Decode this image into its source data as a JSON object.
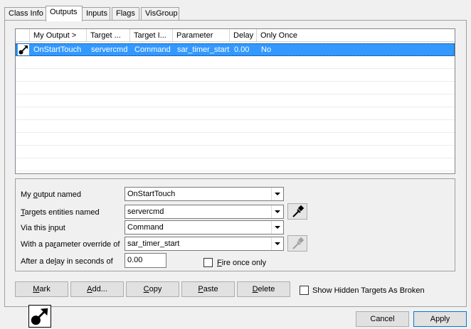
{
  "tabs": [
    "Class Info",
    "Outputs",
    "Inputs",
    "Flags",
    "VisGroup"
  ],
  "active_tab": "Outputs",
  "outputs_list": {
    "columns": [
      "My Output  >",
      "Target ...",
      "Target I...",
      "Parameter",
      "Delay",
      "Only Once"
    ],
    "rows": [
      {
        "output": "OnStartTouch",
        "target": "servercmd",
        "input": "Command",
        "parameter": "sar_timer_start",
        "delay": "0.00",
        "only_once": "No"
      }
    ]
  },
  "form": {
    "output_named_label_pre": "My ",
    "output_named_label_u": "o",
    "output_named_label_post": "utput named",
    "output_named_value": "OnStartTouch",
    "targets_label_u": "T",
    "targets_label_post": "argets entities named",
    "targets_value": "servercmd",
    "via_input_label_pre": "Via this ",
    "via_input_label_u": "i",
    "via_input_label_post": "nput",
    "via_input_value": "Command",
    "param_label_pre": "With a pa",
    "param_label_u": "r",
    "param_label_post": "ameter override of",
    "param_value": "sar_timer_start",
    "delay_label_pre": "After a de",
    "delay_label_u": "l",
    "delay_label_post": "ay in seconds of",
    "delay_value": "0.00",
    "fire_once_u": "F",
    "fire_once_post": "ire once only"
  },
  "buttons": {
    "mark_u": "M",
    "mark_post": "ark",
    "add_u": "A",
    "add_post": "dd...",
    "copy_u": "C",
    "copy_post": "opy",
    "paste_u": "P",
    "paste_post": "aste",
    "delete_u": "D",
    "delete_post": "elete",
    "show_hidden": "Show Hidden Targets As Broken",
    "cancel": "Cancel",
    "apply": "Apply"
  },
  "icons": {
    "output_row": "output-arrow-icon",
    "eyedropper": "eyedropper-icon"
  }
}
